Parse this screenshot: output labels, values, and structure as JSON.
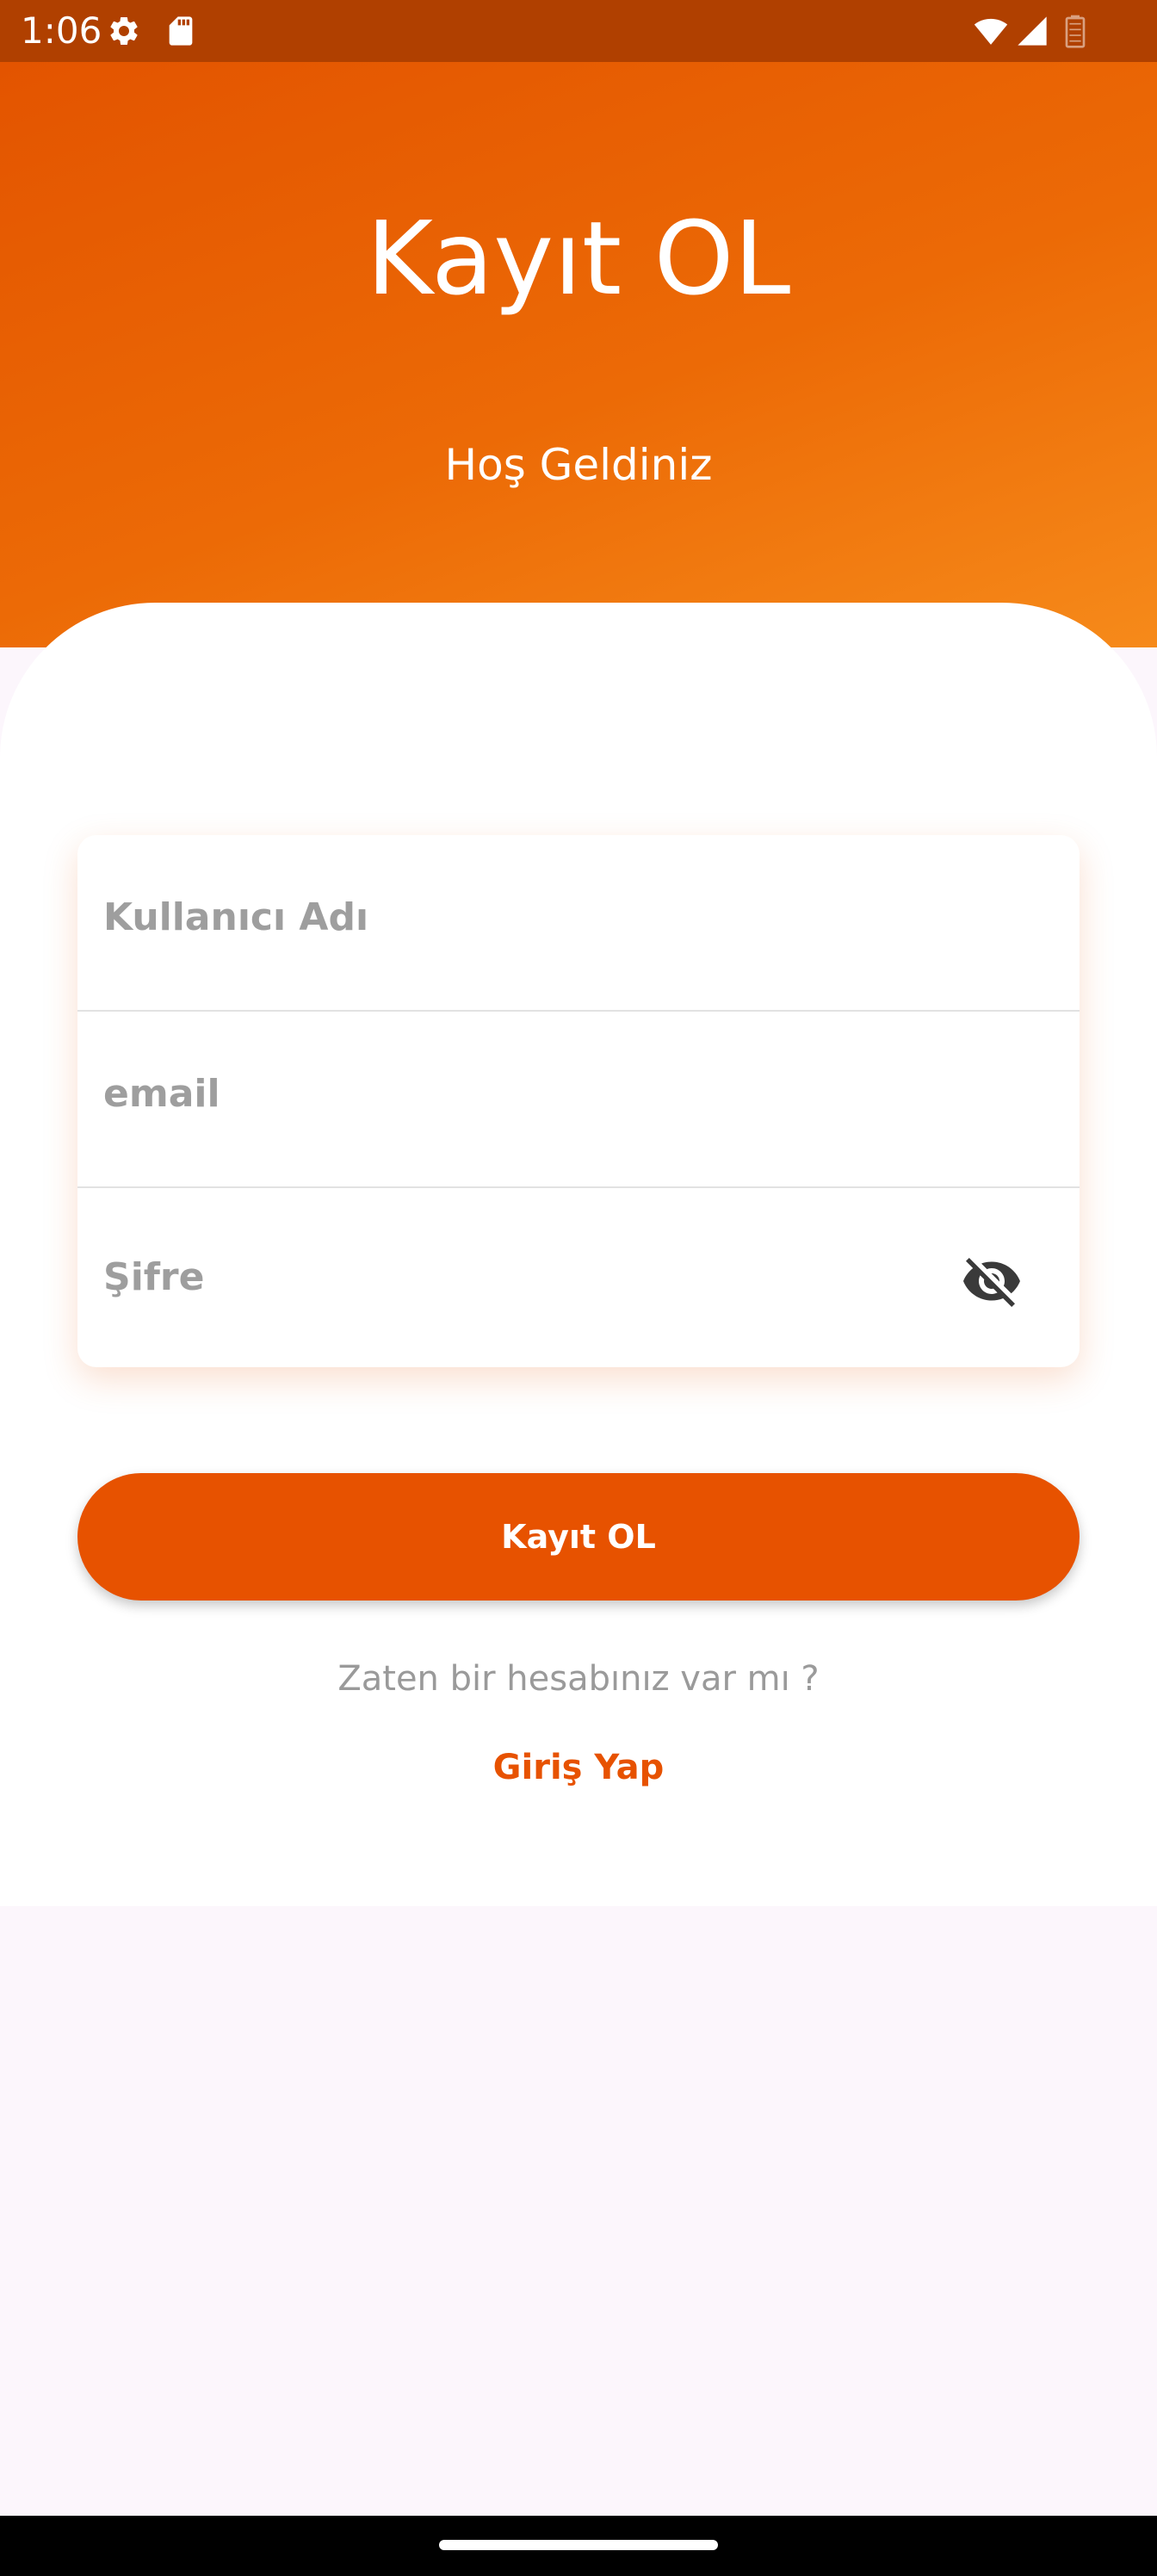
{
  "status_bar": {
    "time": "1:06",
    "left_icons": [
      "gear-icon",
      "sd-card-icon"
    ],
    "right_icons": [
      "wifi-icon",
      "cell-signal-icon",
      "battery-icon"
    ]
  },
  "header": {
    "title": "Kayıt OL",
    "subtitle": "Hoş Geldiniz"
  },
  "form": {
    "username_placeholder": "Kullanıcı Adı",
    "email_placeholder": "email",
    "password_placeholder": "Şifre",
    "password_toggle_icon": "eye-off-icon"
  },
  "register_button_label": "Kayıt OL",
  "login_prompt": "Zaten bir hesabınız var mı ?",
  "login_link": "Giriş Yap",
  "colors": {
    "primary": "#e75200",
    "header_gradient": [
      "#e35400",
      "#f68a1a"
    ],
    "status_bar": "#b04000",
    "placeholder": "#9e9e9e",
    "page_background": "#fcf6fc"
  }
}
